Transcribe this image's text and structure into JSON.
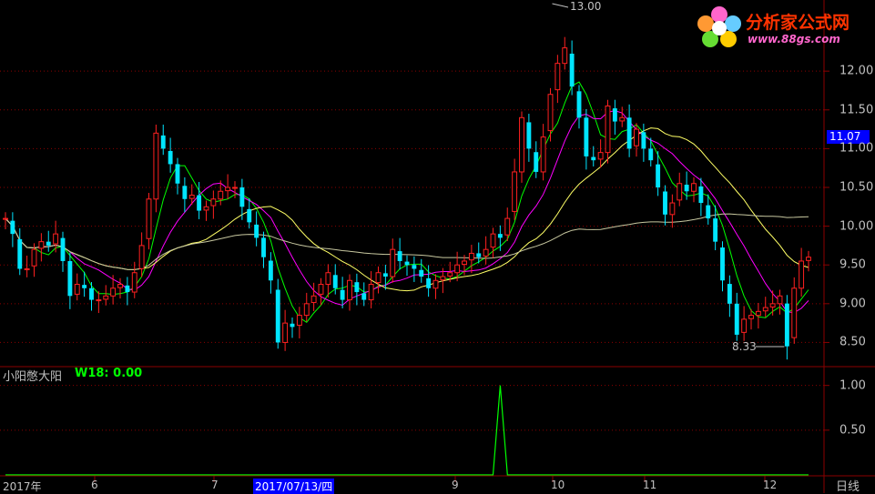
{
  "chart_data": [
    {
      "type": "candlestick",
      "title": "",
      "period_label": "日线",
      "y_ticks": [
        8.5,
        9.0,
        9.5,
        10.0,
        10.5,
        11.0,
        11.5,
        12.0
      ],
      "ylim": [
        8.2,
        12.8
      ],
      "last_price": "11.07",
      "high_marker": "13.00",
      "low_marker": "8.33",
      "x_tick_labels": [
        "2017年",
        "6",
        "7",
        "9",
        "10",
        "11",
        "12"
      ],
      "cursor_date": "2017/07/13/四",
      "up_color": "#ff2020",
      "down_color": "#00e5ff",
      "ma_colors": [
        "#00ff00",
        "#ff00ff",
        "#ffff66",
        "#c8c8a0"
      ],
      "close": [
        10.1,
        9.9,
        9.45,
        9.45,
        9.7,
        9.8,
        9.75,
        9.9,
        9.55,
        9.1,
        9.25,
        9.2,
        9.05,
        9.05,
        9.1,
        9.2,
        9.25,
        9.15,
        9.4,
        9.75,
        10.35,
        11.2,
        11.0,
        10.8,
        10.55,
        10.35,
        10.4,
        10.2,
        10.25,
        10.35,
        10.45,
        10.5,
        10.5,
        10.25,
        10.05,
        9.85,
        9.6,
        9.3,
        8.5,
        8.75,
        8.7,
        8.85,
        9.0,
        9.1,
        9.25,
        9.4,
        9.2,
        9.05,
        9.3,
        9.15,
        9.05,
        9.25,
        9.4,
        9.35,
        9.7,
        9.55,
        9.5,
        9.45,
        9.35,
        9.2,
        9.3,
        9.35,
        9.4,
        9.5,
        9.55,
        9.65,
        9.6,
        9.7,
        9.9,
        9.85,
        10.1,
        10.7,
        11.4,
        11.0,
        10.7,
        11.15,
        11.7,
        12.1,
        12.3,
        11.8,
        11.4,
        10.9,
        10.85,
        10.95,
        11.55,
        11.35,
        11.4,
        11.0,
        11.25,
        11.0,
        10.85,
        10.5,
        10.15,
        10.3,
        10.55,
        10.45,
        10.55,
        10.3,
        10.1,
        9.8,
        9.3,
        9.0,
        8.6,
        8.8,
        8.85,
        8.9,
        8.95,
        9.0,
        9.1,
        8.45,
        9.2,
        9.55,
        9.6
      ],
      "indicator": {
        "name": "小阳憋大阳",
        "value_label": "W18: 0.00",
        "y_ticks": [
          0.5,
          1.0
        ],
        "ylim": [
          0,
          1.2
        ],
        "values": [
          0,
          0,
          0,
          0,
          0,
          0,
          0,
          0,
          0,
          0,
          0,
          0,
          0,
          0,
          0,
          0,
          0,
          0,
          0,
          0,
          0,
          0,
          0,
          0,
          0,
          0,
          0,
          0,
          0,
          0,
          0,
          0,
          0,
          0,
          0,
          0,
          0,
          0,
          0,
          0,
          0,
          0,
          0,
          0,
          0,
          0,
          0,
          0,
          0,
          0,
          0,
          0,
          0,
          0,
          0,
          0,
          0,
          0,
          0,
          0,
          0,
          0,
          0,
          0,
          0,
          0,
          0,
          0,
          0,
          1,
          0,
          0,
          0,
          0,
          0,
          0,
          0,
          0,
          0,
          0,
          0,
          0,
          0,
          0,
          0,
          0,
          0,
          0,
          0,
          0,
          0,
          0,
          0,
          0,
          0,
          0,
          0,
          0,
          0,
          0,
          0,
          0,
          0,
          0,
          0,
          0,
          0,
          0,
          0,
          0,
          0,
          0,
          0
        ],
        "color": "#00ff00"
      }
    }
  ],
  "logo": {
    "name": "分析家公式网",
    "url": "www.88gs.com"
  }
}
